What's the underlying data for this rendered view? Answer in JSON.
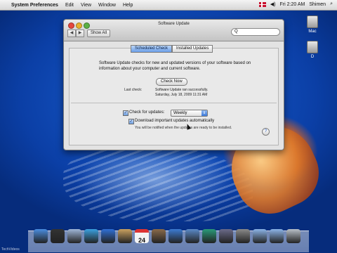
{
  "menubar": {
    "apple": "",
    "app_name": "System Preferences",
    "menus": [
      "Edit",
      "View",
      "Window",
      "Help"
    ],
    "clock": "Fri 2:20 AM",
    "user": "Shimen"
  },
  "desktop": {
    "icons": [
      {
        "label": "Mac"
      },
      {
        "label": "D"
      }
    ]
  },
  "window": {
    "title": "Software Update",
    "back_icon": "◀",
    "forward_icon": "▶",
    "show_all": "Show All",
    "search_glyph": "Q",
    "tabs": [
      {
        "label": "Scheduled Check",
        "active": true
      },
      {
        "label": "Installed Updates",
        "active": false
      }
    ],
    "description": "Software Update checks for new and updated versions of your software based on information about your computer and current software.",
    "check_now": "Check Now",
    "last_check_label": "Last check:",
    "last_check_line1": "Software Update ran successfully.",
    "last_check_line2": "Saturday, July 18, 2009 11:31 AM",
    "check_for_updates_label": "Check for updates:",
    "check_for_updates_checked": true,
    "frequency": "Weekly",
    "download_label": "Download important updates automatically",
    "download_checked": true,
    "download_note": "You will be notified when the updates are ready to be installed.",
    "help": "?"
  },
  "dock": {
    "items": [
      {
        "icon": "finder-icon",
        "color": "#4a8de0"
      },
      {
        "icon": "dashboard-icon",
        "color": "#333333"
      },
      {
        "icon": "mail-icon",
        "color": "#9fb6d8"
      },
      {
        "icon": "safari-icon",
        "color": "#3aa0e0"
      },
      {
        "icon": "ichat-icon",
        "color": "#2f6fd6"
      },
      {
        "icon": "address-book-icon",
        "color": "#c9a060"
      },
      {
        "icon": "ical-icon",
        "color": "#e0e0e0"
      },
      {
        "icon": "preview-icon",
        "color": "#8a6a4a"
      },
      {
        "icon": "itunes-icon",
        "color": "#3c7bd2"
      },
      {
        "icon": "iphoto-icon",
        "color": "#5a8ac8"
      },
      {
        "icon": "time-machine-icon",
        "color": "#2a9a7a"
      },
      {
        "icon": "spaces-icon",
        "color": "#6a6a8a"
      },
      {
        "icon": "system-preferences-icon",
        "color": "#8a8a8a"
      },
      {
        "icon": "folder-icon",
        "color": "#8cb4e8"
      },
      {
        "icon": "downloads-icon",
        "color": "#8cb4e8"
      },
      {
        "icon": "trash-icon",
        "color": "#b8c0c8"
      }
    ],
    "calendar_day": "24"
  },
  "corner_watermark": "TechVideos"
}
